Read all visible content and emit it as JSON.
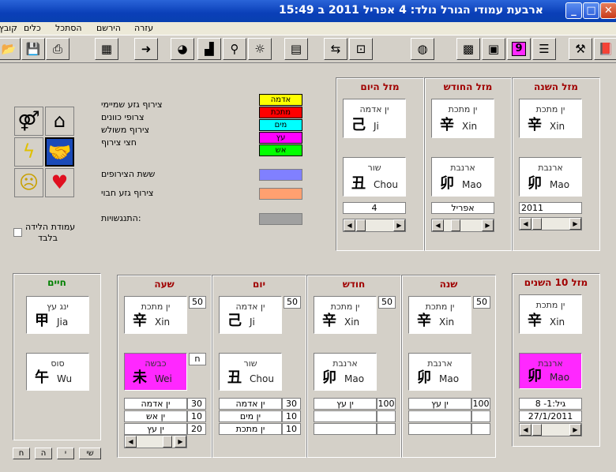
{
  "window": {
    "title": "ארבעת עמודי הגורל   נולד:  4 אפריל 2011 ב 15:49"
  },
  "menu": [
    "קובץ",
    "כלים",
    "הסתכל",
    "הירשם",
    "עזרה"
  ],
  "toolbar": {
    "buttons": [
      "open-icon",
      "save-icon",
      "print-icon",
      "properties-icon",
      "arrow-right-icon",
      "pie-chart-icon",
      "bar-chart-icon",
      "magnifier-icon",
      "light-bulb-icon",
      "book-icon",
      "export-icon",
      "presentation-icon",
      "globe-icon",
      "grid-chart-icon",
      "color-grid-icon",
      "nine-icon",
      "hexagram-icon",
      "tools-icon",
      "book-red-icon"
    ],
    "nine_label": "9"
  },
  "legend": {
    "combos": [
      "צירוף גזע שמיימי",
      "צרופי כוונים",
      "צירוף משולש",
      "חצי צירוף"
    ],
    "six_combos": "ששת הצירופים",
    "stem_combo": "צירוף גזע חבוי",
    "clashes": "התנגשויות:",
    "checkbox_label_1": "עמודת הלידה",
    "checkbox_label_2": "בלבד",
    "elements": [
      {
        "label": "אדמה",
        "color": "#ffff00"
      },
      {
        "label": "מתכת",
        "color": "#ff0000"
      },
      {
        "label": "מים",
        "color": "#00ffff"
      },
      {
        "label": "עץ",
        "color": "#ff00ff"
      },
      {
        "label": "אש",
        "color": "#00ff00"
      }
    ],
    "swatch_six": "#8080ff",
    "swatch_stem": "#ffa070",
    "swatch_clash": "#a0a0a0"
  },
  "luck_year": {
    "header": "מזל השנה",
    "stem": {
      "heb": "ין מתכת",
      "han": "辛",
      "lat": "Xin"
    },
    "branch": {
      "heb": "ארנבת",
      "han": "卯",
      "lat": "Mao"
    },
    "value": "2011"
  },
  "luck_month": {
    "header": "מזל החודש",
    "stem": {
      "heb": "ין מתכת",
      "han": "辛",
      "lat": "Xin"
    },
    "branch": {
      "heb": "ארנבת",
      "han": "卯",
      "lat": "Mao"
    },
    "value": "אפריל"
  },
  "luck_day": {
    "header": "מזל היום",
    "stem": {
      "heb": "ין אדמה",
      "han": "己",
      "lat": "Ji"
    },
    "branch": {
      "heb": "שור",
      "han": "丑",
      "lat": "Chou"
    },
    "value": "4"
  },
  "decade": {
    "header": "מזל 10 השנים",
    "stem": {
      "heb": "ין מתכת",
      "han": "辛",
      "lat": "Xin"
    },
    "branch": {
      "heb": "ארנבת",
      "han": "卯",
      "lat": "Mao"
    },
    "age": "גיל:1- 8",
    "date": "27/1/2011"
  },
  "pillars": {
    "year": {
      "header": "שנה",
      "score": "50",
      "stem": {
        "heb": "ין מתכת",
        "han": "辛",
        "lat": "Xin"
      },
      "branch": {
        "heb": "ארנבת",
        "han": "卯",
        "lat": "Mao"
      },
      "hidden": [
        {
          "name": "ין עץ",
          "val": "100"
        }
      ]
    },
    "month": {
      "header": "חודש",
      "score": "50",
      "stem": {
        "heb": "ין מתכת",
        "han": "辛",
        "lat": "Xin"
      },
      "branch": {
        "heb": "ארנבת",
        "han": "卯",
        "lat": "Mao"
      },
      "hidden": [
        {
          "name": "ין עץ",
          "val": "100"
        }
      ]
    },
    "day": {
      "header": "יום",
      "score": "50",
      "stem": {
        "heb": "ין אדמה",
        "han": "己",
        "lat": "Ji"
      },
      "branch": {
        "heb": "שור",
        "han": "丑",
        "lat": "Chou"
      },
      "hidden": [
        {
          "name": "ין אדמה",
          "val": "30"
        },
        {
          "name": "ין מים",
          "val": "10"
        },
        {
          "name": "ין מתכת",
          "val": "10"
        }
      ]
    },
    "hour": {
      "header": "שעה",
      "score": "50",
      "branch_badge": "ח",
      "stem": {
        "heb": "ין מתכת",
        "han": "辛",
        "lat": "Xin"
      },
      "branch": {
        "heb": "כבשה",
        "han": "未",
        "lat": "Wei"
      },
      "hidden": [
        {
          "name": "ין אדמה",
          "val": "30"
        },
        {
          "name": "ין אש",
          "val": "10"
        },
        {
          "name": "ין עץ",
          "val": "20"
        }
      ]
    }
  },
  "life": {
    "header": "חיים",
    "stem": {
      "heb": "ינג עץ",
      "han": "甲",
      "lat": "Jia"
    },
    "branch": {
      "heb": "סוס",
      "han": "午",
      "lat": "Wu"
    }
  },
  "bottom_buttons": [
    "שי",
    "י",
    "ה",
    "ח"
  ]
}
